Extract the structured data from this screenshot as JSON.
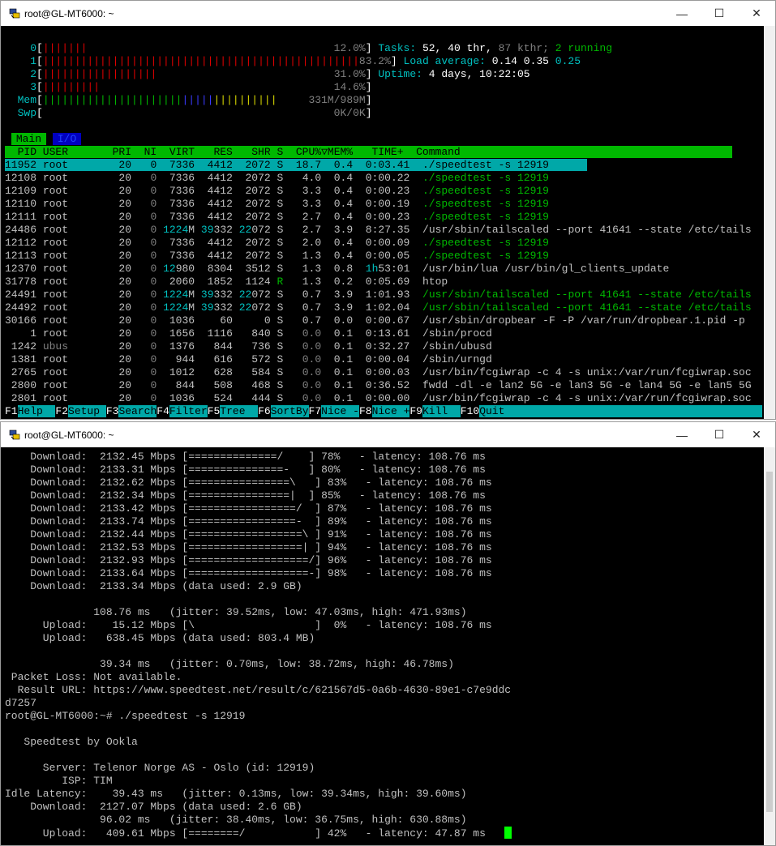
{
  "windows": {
    "top_title": "root@GL-MT6000: ~",
    "bottom_title": "root@GL-MT6000: ~"
  },
  "htop": {
    "cpus": [
      {
        "label": "0",
        "bar": "|||||||",
        "pct": "12.0%"
      },
      {
        "label": "1",
        "bar": "||||||||||||||||||||||||||||||||||||||||||||||||||",
        "pct": "83.2%"
      },
      {
        "label": "2",
        "bar": "||||||||||||||||||",
        "pct": "31.0%"
      },
      {
        "label": "3",
        "bar": "|||||||||",
        "pct": "14.6%"
      }
    ],
    "mem_label": "Mem",
    "mem_bar_green": "||||||||||||||||||||||",
    "mem_bar_blue": "|||||",
    "mem_bar_yellow": "||||||||||",
    "mem_value": "331M/989M",
    "swp_label": "Swp",
    "swp_value": "0K/0K",
    "tasks_label": "Tasks:",
    "tasks_value": "52, 40 thr,",
    "kthr": "87 kthr;",
    "running": "2 running",
    "load_label": "Load average:",
    "load_1": "0.14",
    "load_5": "0.35",
    "load_15": "0.25",
    "uptime_label": "Uptime:",
    "uptime_value": "4 days, 10:22:05",
    "tabs": [
      "Main",
      "I/O"
    ],
    "header": "  PID USER       PRI  NI  VIRT   RES   SHR S  CPU%▽MEM%   TIME+  Command",
    "processes": [
      {
        "pid": "11952",
        "user": "root",
        "pri": "20",
        "ni": "0",
        "virt": "7336",
        "res": "4412",
        "shr": "2072",
        "s": "S",
        "cpu": "18.7",
        "mem": "0.4",
        "time": "0:03.41",
        "cmd": "./speedtest -s 12919"
      },
      {
        "pid": "12108",
        "user": "root",
        "pri": "20",
        "ni": "0",
        "virt": "7336",
        "res": "4412",
        "shr": "2072",
        "s": "S",
        "cpu": "4.0",
        "mem": "0.4",
        "time": "0:00.22",
        "cmd": "./speedtest -s 12919"
      },
      {
        "pid": "12109",
        "user": "root",
        "pri": "20",
        "ni": "0",
        "virt": "7336",
        "res": "4412",
        "shr": "2072",
        "s": "S",
        "cpu": "3.3",
        "mem": "0.4",
        "time": "0:00.23",
        "cmd": "./speedtest -s 12919"
      },
      {
        "pid": "12110",
        "user": "root",
        "pri": "20",
        "ni": "0",
        "virt": "7336",
        "res": "4412",
        "shr": "2072",
        "s": "S",
        "cpu": "3.3",
        "mem": "0.4",
        "time": "0:00.19",
        "cmd": "./speedtest -s 12919"
      },
      {
        "pid": "12111",
        "user": "root",
        "pri": "20",
        "ni": "0",
        "virt": "7336",
        "res": "4412",
        "shr": "2072",
        "s": "S",
        "cpu": "2.7",
        "mem": "0.4",
        "time": "0:00.23",
        "cmd": "./speedtest -s 12919"
      },
      {
        "pid": "24486",
        "user": "root",
        "pri": "20",
        "ni": "0",
        "virt": "1224M",
        "res": "39332",
        "shr": "22072",
        "s": "S",
        "cpu": "2.7",
        "mem": "3.9",
        "time": "8:27.35",
        "cmd": "/usr/sbin/tailscaled --port 41641 --state /etc/tails"
      },
      {
        "pid": "12112",
        "user": "root",
        "pri": "20",
        "ni": "0",
        "virt": "7336",
        "res": "4412",
        "shr": "2072",
        "s": "S",
        "cpu": "2.0",
        "mem": "0.4",
        "time": "0:00.09",
        "cmd": "./speedtest -s 12919"
      },
      {
        "pid": "12113",
        "user": "root",
        "pri": "20",
        "ni": "0",
        "virt": "7336",
        "res": "4412",
        "shr": "2072",
        "s": "S",
        "cpu": "1.3",
        "mem": "0.4",
        "time": "0:00.05",
        "cmd": "./speedtest -s 12919"
      },
      {
        "pid": "12370",
        "user": "root",
        "pri": "20",
        "ni": "0",
        "virt": "12980",
        "res": "8304",
        "shr": "3512",
        "s": "S",
        "cpu": "1.3",
        "mem": "0.8",
        "time": "1h53:01",
        "cmd": "/usr/bin/lua /usr/bin/gl_clients_update"
      },
      {
        "pid": "31778",
        "user": "root",
        "pri": "20",
        "ni": "0",
        "virt": "2060",
        "res": "1852",
        "shr": "1124",
        "s": "R",
        "cpu": "1.3",
        "mem": "0.2",
        "time": "0:05.69",
        "cmd": "htop"
      },
      {
        "pid": "24491",
        "user": "root",
        "pri": "20",
        "ni": "0",
        "virt": "1224M",
        "res": "39332",
        "shr": "22072",
        "s": "S",
        "cpu": "0.7",
        "mem": "3.9",
        "time": "1:01.93",
        "cmd": "/usr/sbin/tailscaled --port 41641 --state /etc/tails"
      },
      {
        "pid": "24492",
        "user": "root",
        "pri": "20",
        "ni": "0",
        "virt": "1224M",
        "res": "39332",
        "shr": "22072",
        "s": "S",
        "cpu": "0.7",
        "mem": "3.9",
        "time": "1:02.04",
        "cmd": "/usr/sbin/tailscaled --port 41641 --state /etc/tails"
      },
      {
        "pid": "30166",
        "user": "root",
        "pri": "20",
        "ni": "0",
        "virt": "1036",
        "res": "60",
        "shr": "0",
        "s": "S",
        "cpu": "0.7",
        "mem": "0.0",
        "time": "0:00.67",
        "cmd": "/usr/sbin/dropbear -F -P /var/run/dropbear.1.pid -p"
      },
      {
        "pid": "1",
        "user": "root",
        "pri": "20",
        "ni": "0",
        "virt": "1656",
        "res": "1116",
        "shr": "840",
        "s": "S",
        "cpu": "0.0",
        "mem": "0.1",
        "time": "0:13.61",
        "cmd": "/sbin/procd"
      },
      {
        "pid": "1242",
        "user": "ubus",
        "pri": "20",
        "ni": "0",
        "virt": "1376",
        "res": "844",
        "shr": "736",
        "s": "S",
        "cpu": "0.0",
        "mem": "0.1",
        "time": "0:32.27",
        "cmd": "/sbin/ubusd"
      },
      {
        "pid": "1381",
        "user": "root",
        "pri": "20",
        "ni": "0",
        "virt": "944",
        "res": "616",
        "shr": "572",
        "s": "S",
        "cpu": "0.0",
        "mem": "0.1",
        "time": "0:00.04",
        "cmd": "/sbin/urngd"
      },
      {
        "pid": "2765",
        "user": "root",
        "pri": "20",
        "ni": "0",
        "virt": "1012",
        "res": "628",
        "shr": "584",
        "s": "S",
        "cpu": "0.0",
        "mem": "0.1",
        "time": "0:00.03",
        "cmd": "/usr/bin/fcgiwrap -c 4 -s unix:/var/run/fcgiwrap.soc"
      },
      {
        "pid": "2800",
        "user": "root",
        "pri": "20",
        "ni": "0",
        "virt": "844",
        "res": "508",
        "shr": "468",
        "s": "S",
        "cpu": "0.0",
        "mem": "0.1",
        "time": "0:36.52",
        "cmd": "fwdd -dl -e lan2 5G -e lan3 5G -e lan4 5G -e lan5 5G"
      },
      {
        "pid": "2801",
        "user": "root",
        "pri": "20",
        "ni": "0",
        "virt": "1036",
        "res": "524",
        "shr": "444",
        "s": "S",
        "cpu": "0.0",
        "mem": "0.1",
        "time": "0:00.00",
        "cmd": "/usr/bin/fcgiwrap -c 4 -s unix:/var/run/fcgiwrap.soc"
      }
    ],
    "fkeys": [
      {
        "key": "F1",
        "label": "Help  "
      },
      {
        "key": "F2",
        "label": "Setup "
      },
      {
        "key": "F3",
        "label": "Search"
      },
      {
        "key": "F4",
        "label": "Filter"
      },
      {
        "key": "F5",
        "label": "Tree  "
      },
      {
        "key": "F6",
        "label": "SortBy"
      },
      {
        "key": "F7",
        "label": "Nice -"
      },
      {
        "key": "F8",
        "label": "Nice +"
      },
      {
        "key": "F9",
        "label": "Kill  "
      },
      {
        "key": "F10",
        "label": "Quit                                          "
      }
    ]
  },
  "speedtest_lines": [
    "    Download:  2132.45 Mbps [==============/    ] 78%   - latency: 108.76 ms",
    "    Download:  2133.31 Mbps [===============-   ] 80%   - latency: 108.76 ms",
    "    Download:  2132.62 Mbps [================\\   ] 83%   - latency: 108.76 ms",
    "    Download:  2132.34 Mbps [================|  ] 85%   - latency: 108.76 ms",
    "    Download:  2133.42 Mbps [=================/  ] 87%   - latency: 108.76 ms",
    "    Download:  2133.74 Mbps [=================-  ] 89%   - latency: 108.76 ms",
    "    Download:  2132.44 Mbps [==================\\ ] 91%   - latency: 108.76 ms",
    "    Download:  2132.53 Mbps [==================| ] 94%   - latency: 108.76 ms",
    "    Download:  2132.93 Mbps [===================/] 96%   - latency: 108.76 ms",
    "    Download:  2133.64 Mbps [===================-] 98%   - latency: 108.76 ms",
    "    Download:  2133.34 Mbps (data used: 2.9 GB)",
    "",
    "              108.76 ms   (jitter: 39.52ms, low: 47.03ms, high: 471.93ms)",
    "      Upload:    15.12 Mbps [\\                   ]  0%   - latency: 108.76 ms",
    "      Upload:   638.45 Mbps (data used: 803.4 MB)",
    "",
    "               39.34 ms   (jitter: 0.70ms, low: 38.72ms, high: 46.78ms)",
    " Packet Loss: Not available.",
    "  Result URL: https://www.speedtest.net/result/c/621567d5-0a6b-4630-89e1-c7e9ddc",
    "d7257",
    "root@GL-MT6000:~# ./speedtest -s 12919",
    "",
    "   Speedtest by Ookla",
    "",
    "      Server: Telenor Norge AS - Oslo (id: 12919)",
    "         ISP: TIM",
    "Idle Latency:    39.43 ms   (jitter: 0.13ms, low: 39.34ms, high: 39.60ms)",
    "    Download:  2127.07 Mbps (data used: 2.6 GB)",
    "               96.02 ms   (jitter: 38.40ms, low: 36.75ms, high: 630.88ms)",
    "      Upload:   409.61 Mbps [========/           ] 42%   - latency: 47.87 ms   "
  ],
  "colors": {
    "green": "#00b800",
    "cyan": "#00a8a8",
    "red": "#e00000",
    "blue": "#3a3aff",
    "yellow": "#d8d800"
  }
}
